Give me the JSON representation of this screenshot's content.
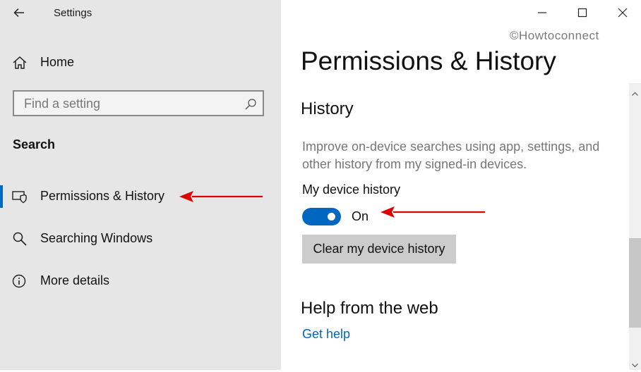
{
  "window": {
    "title": "Settings"
  },
  "sidebar": {
    "home_label": "Home",
    "search_placeholder": "Find a setting",
    "section_title": "Search",
    "items": [
      {
        "label": "Permissions & History",
        "icon": "shield-monitor-icon",
        "active": true
      },
      {
        "label": "Searching Windows",
        "icon": "search-icon",
        "active": false
      },
      {
        "label": "More details",
        "icon": "info-icon",
        "active": false
      }
    ]
  },
  "watermark": "©Howtoconnect",
  "main": {
    "title": "Permissions & History",
    "history": {
      "heading": "History",
      "description": "Improve on-device searches using app, settings, and other history from my signed-in devices.",
      "device_history_label": "My device history",
      "toggle_state": "On",
      "clear_button": "Clear my device history"
    },
    "help": {
      "heading": "Help from the web",
      "link": "Get help"
    }
  },
  "colors": {
    "accent": "#0067c0",
    "sidebar_bg": "#e6e6e6",
    "annotation_arrow": "#e00000"
  }
}
